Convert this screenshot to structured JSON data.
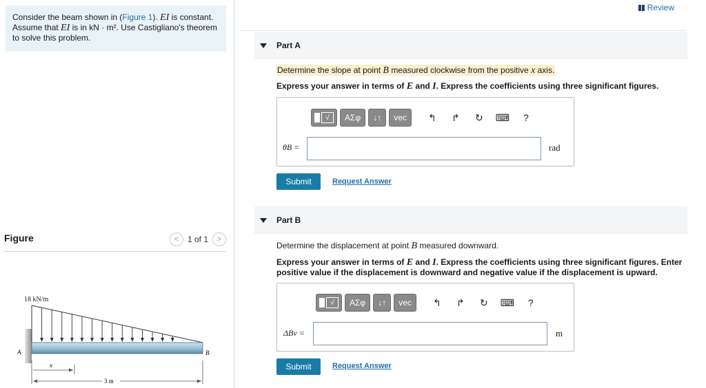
{
  "problem": {
    "text1": "Consider the beam shown in (",
    "figure_link": "Figure 1",
    "text2": "). ",
    "ei1": "EI",
    "text3": " is constant. Assume that ",
    "ei2": "EI",
    "text4": " is in kN · m². Use Castigliano's theorem to solve this problem."
  },
  "figure": {
    "title": "Figure",
    "pager": "1 of 1",
    "load_label": "18 kN/m",
    "label_a": "A",
    "label_b": "B",
    "label_x": "x",
    "length_label": "3 m"
  },
  "review_label": "Review",
  "toolbar": {
    "templates": "√",
    "greek": "ΑΣφ",
    "arrows": "↓↑",
    "vec": "vec",
    "undo": "↰",
    "redo": "↱",
    "reset": "↻",
    "keyboard": "⌨",
    "help": "?"
  },
  "partA": {
    "title": "Part A",
    "prompt_pre": "Determine the slope at point ",
    "prompt_var": "B",
    "prompt_post": " measured clockwise from the positive ",
    "prompt_axis": "x",
    "prompt_end": " axis.",
    "express_pre": "Express your answer in terms of ",
    "express_e": "E",
    "express_and": " and ",
    "express_i": "I",
    "express_post": ". Express the coefficients using three significant figures.",
    "eq_label": "θB =",
    "answer_value": "",
    "unit": "rad",
    "submit": "Submit",
    "request": "Request Answer"
  },
  "partB": {
    "title": "Part B",
    "prompt_pre": "Determine the displacement at point ",
    "prompt_var": "B",
    "prompt_post": " measured downward.",
    "express_pre": "Express your answer in terms of ",
    "express_e": "E",
    "express_and": " and ",
    "express_i": "I",
    "express_post": ". Express the coefficients using three significant figures. Enter positive value if the displacement is downward and negative value if the displacement is upward.",
    "eq_label": "ΔBv =",
    "answer_value": "",
    "unit": "m",
    "submit": "Submit",
    "request": "Request Answer"
  }
}
